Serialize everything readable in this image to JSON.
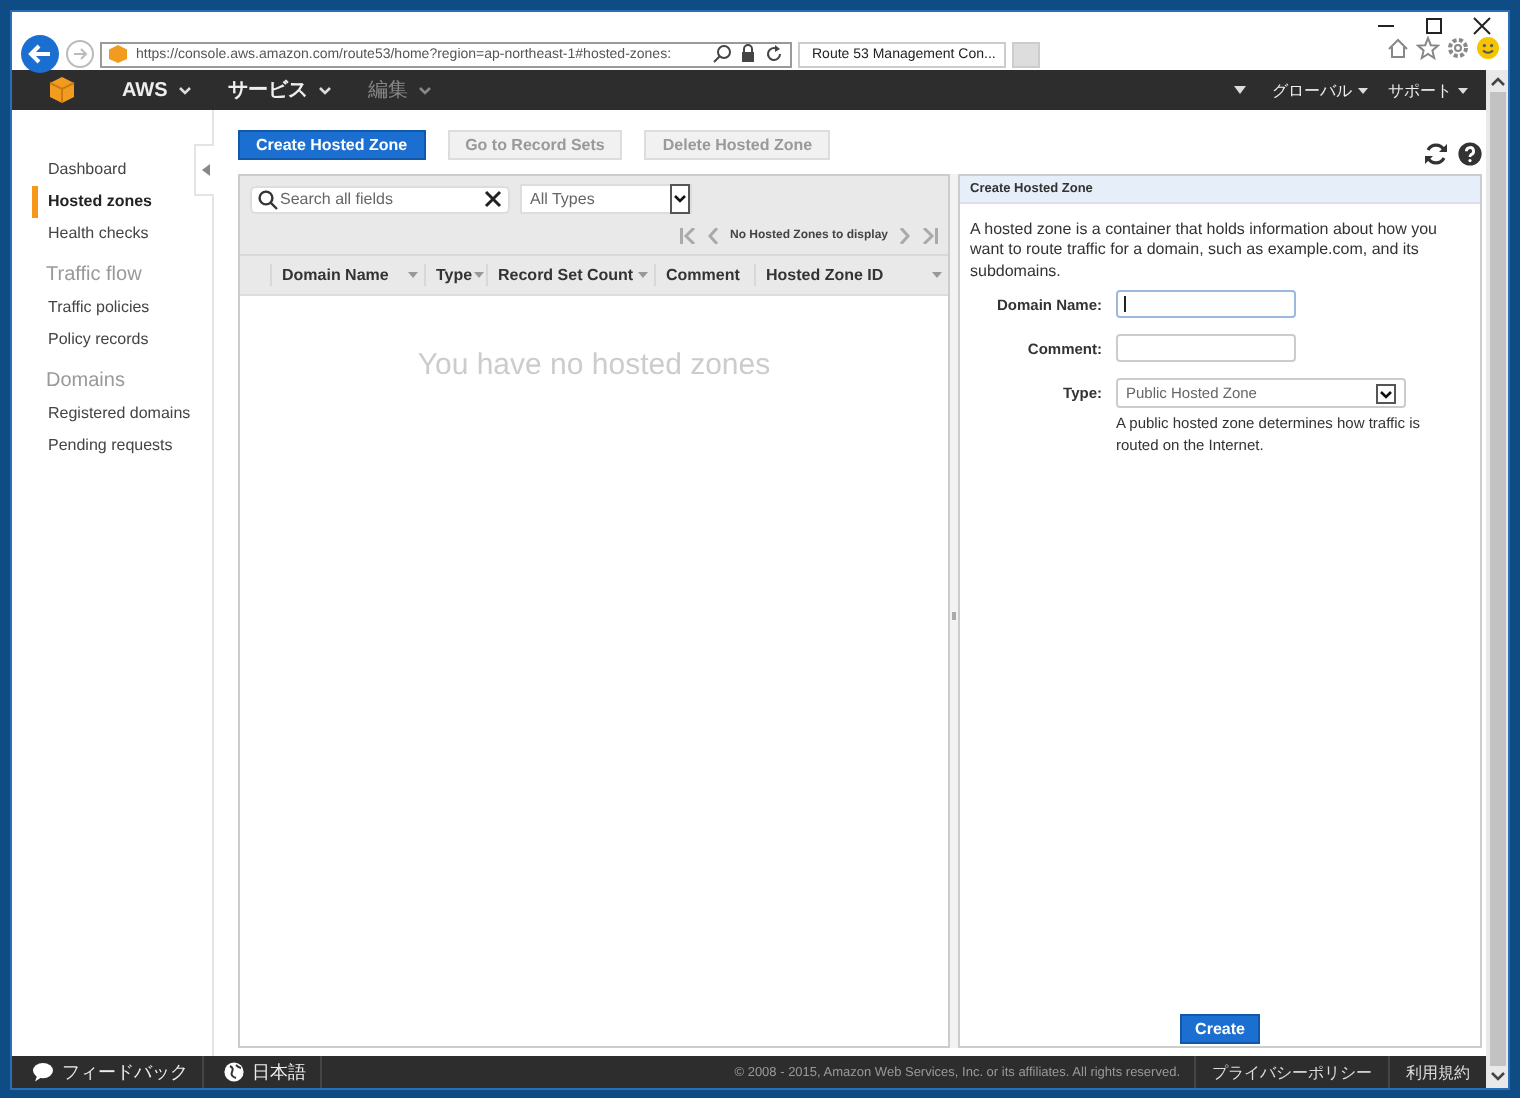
{
  "browser": {
    "address": "https://console.aws.amazon.com/route53/home?region=ap-northeast-1#hosted-zones:",
    "tab_title": "Route 53 Management Con..."
  },
  "nav": {
    "left": [
      {
        "label": "AWS",
        "has_menu": true,
        "disabled": false
      },
      {
        "label": "サービス",
        "has_menu": true,
        "disabled": false
      },
      {
        "label": "編集",
        "has_menu": true,
        "disabled": true
      }
    ],
    "right": [
      {
        "label": "グローバル",
        "has_menu": true
      },
      {
        "label": "サポート",
        "has_menu": true
      }
    ]
  },
  "sidebar": {
    "items": [
      {
        "kind": "link",
        "label": "Dashboard",
        "selected": false
      },
      {
        "kind": "link",
        "label": "Hosted zones",
        "selected": true
      },
      {
        "kind": "link",
        "label": "Health checks",
        "selected": false
      },
      {
        "kind": "heading",
        "label": "Traffic flow"
      },
      {
        "kind": "link",
        "label": "Traffic policies",
        "selected": false
      },
      {
        "kind": "link",
        "label": "Policy records",
        "selected": false
      },
      {
        "kind": "heading",
        "label": "Domains"
      },
      {
        "kind": "link",
        "label": "Registered domains",
        "selected": false
      },
      {
        "kind": "link",
        "label": "Pending requests",
        "selected": false
      }
    ]
  },
  "toolbar": {
    "buttons": [
      {
        "label": "Create Hosted Zone",
        "disabled": false
      },
      {
        "label": "Go to Record Sets",
        "disabled": true
      },
      {
        "label": "Delete Hosted Zone",
        "disabled": true
      }
    ]
  },
  "table": {
    "search": {
      "placeholder": "Search all fields"
    },
    "type_filter": "All Types",
    "pager": "No Hosted Zones to display",
    "columns": [
      {
        "label": "Domain Name",
        "sortable": true
      },
      {
        "label": "Type",
        "sortable": true
      },
      {
        "label": "Record Set Count",
        "sortable": true
      },
      {
        "label": "Comment",
        "sortable": false
      },
      {
        "label": "Hosted Zone ID",
        "sortable": true
      }
    ],
    "empty_message": "You have no hosted zones"
  },
  "panel": {
    "title": "Create Hosted Zone",
    "description": "A hosted zone is a container that holds information about how you want to route traffic for a domain, such as example.com, and its subdomains.",
    "fields": [
      {
        "kind": "text",
        "label": "Domain Name:",
        "focused": true
      },
      {
        "kind": "text",
        "label": "Comment:",
        "focused": false
      },
      {
        "kind": "select",
        "label": "Type:",
        "value": "Public Hosted Zone",
        "help": "A public hosted zone determines how traffic is routed on the Internet."
      }
    ],
    "submit": "Create"
  },
  "footer": {
    "feedback": "フィードバック",
    "language": "日本語",
    "copyright": "© 2008 - 2015, Amazon Web Services, Inc. or its affiliates. All rights reserved.",
    "links": [
      "プライバシーポリシー",
      "利用規約"
    ]
  }
}
